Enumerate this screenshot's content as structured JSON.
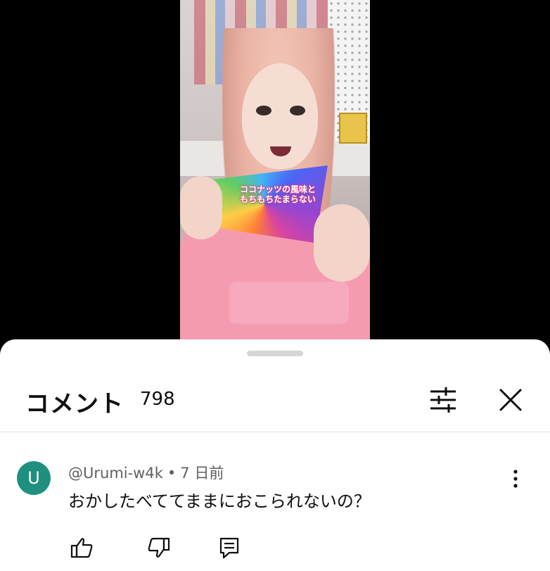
{
  "video": {
    "caption_lines": [
      "ココナッツの風味と",
      "もちもちたまらない"
    ]
  },
  "comments_panel": {
    "title": "コメント",
    "count": "798",
    "filter_icon": "sliders-icon",
    "close_icon": "close-icon"
  },
  "comment": {
    "avatar_letter": "U",
    "avatar_color": "#1f8f7f",
    "author": "@Urumi-w4k",
    "separator": "•",
    "time": "7 日前",
    "text": "おかしたべててままにおこられないの？",
    "more_icon": "more-vertical-icon",
    "actions": {
      "like_icon": "thumbs-up-icon",
      "dislike_icon": "thumbs-down-icon",
      "reply_icon": "reply-icon"
    }
  }
}
